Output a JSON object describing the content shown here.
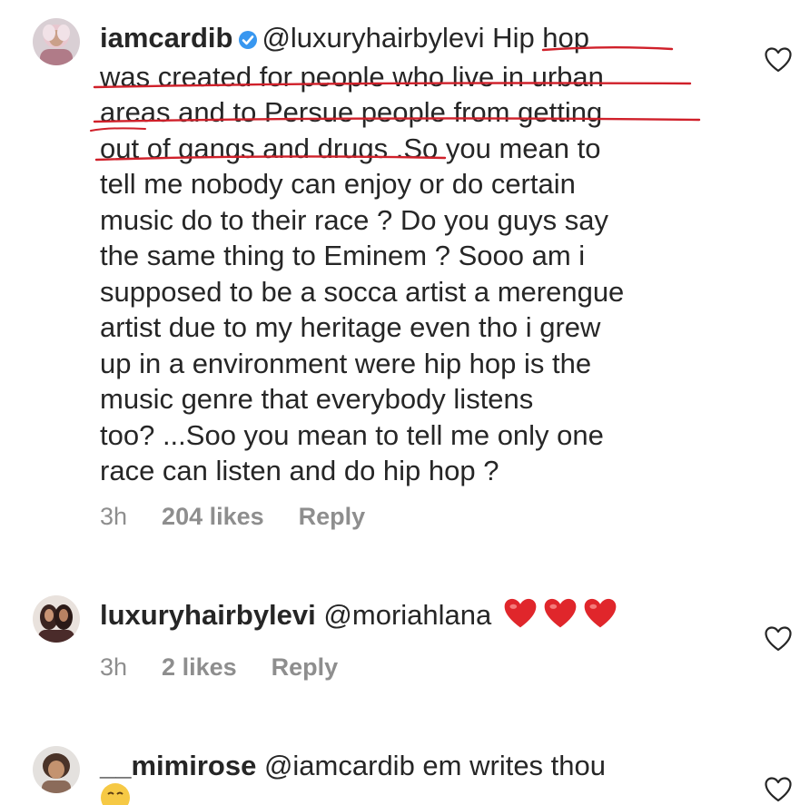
{
  "comments": [
    {
      "username": "iamcardib",
      "verified": true,
      "mention": "@luxuryhairbylevi",
      "lines": [
        " Hip hop",
        "was created for people who live in urban",
        "areas and to Persue people from getting",
        "out of gangs and drugs .So you mean to",
        "tell me nobody can enjoy or do certain",
        "music do to their race ? Do you guys say",
        "the same thing to Eminem ? Sooo am i",
        "supposed to be a socca artist a merengue",
        "artist due to my heritage even tho i grew",
        "up in a environment were hip hop is the",
        "music genre that everybody listens",
        "too? ...Soo you mean to tell me only one",
        "race can listen and do hip hop ?"
      ],
      "time": "3h",
      "likes": "204 likes",
      "reply": "Reply"
    },
    {
      "username": "luxuryhairbylevi",
      "mention": "@moriahlana",
      "time": "3h",
      "likes": "2 likes",
      "reply": "Reply"
    },
    {
      "username": "__mimirose",
      "mention": "@iamcardib",
      "text": " em writes thou"
    }
  ],
  "colors": {
    "text": "#262626",
    "meta": "#8e8e8e",
    "verified": "#3897f0",
    "underline": "#d0202a",
    "heart_emoji": "#e0262b"
  }
}
